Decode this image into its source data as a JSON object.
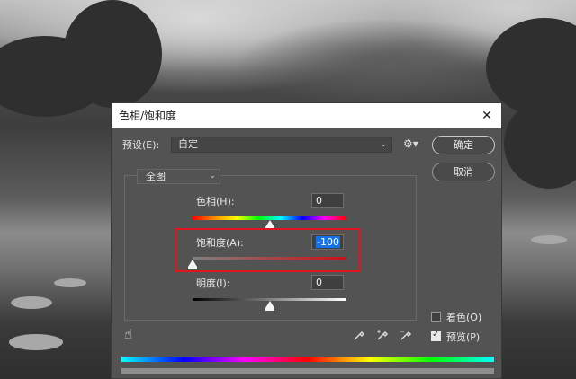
{
  "dialog": {
    "title": "色相/饱和度",
    "preset_label": "预设(E):",
    "preset_value": "自定",
    "ok_label": "确定",
    "cancel_label": "取消",
    "channel_value": "全图"
  },
  "sliders": [
    {
      "label": "色相(H):",
      "value": "0",
      "fraction": 0.5
    },
    {
      "label": "饱和度(A):",
      "value": "-100",
      "fraction": 0.0
    },
    {
      "label": "明度(I):",
      "value": "0",
      "fraction": 0.5
    }
  ],
  "options": {
    "colorize_label": "着色(O)",
    "colorize_checked": false,
    "preview_label": "预览(P)",
    "preview_checked": true
  },
  "icons": {
    "close": "close-icon",
    "gear": "gear-icon",
    "hand": "hand-adjust-icon",
    "droppers": [
      "eyedropper-icon",
      "eyedropper-plus-icon",
      "eyedropper-minus-icon"
    ]
  },
  "colors": {
    "highlight": "#e0141e",
    "selection": "#1473e6"
  }
}
